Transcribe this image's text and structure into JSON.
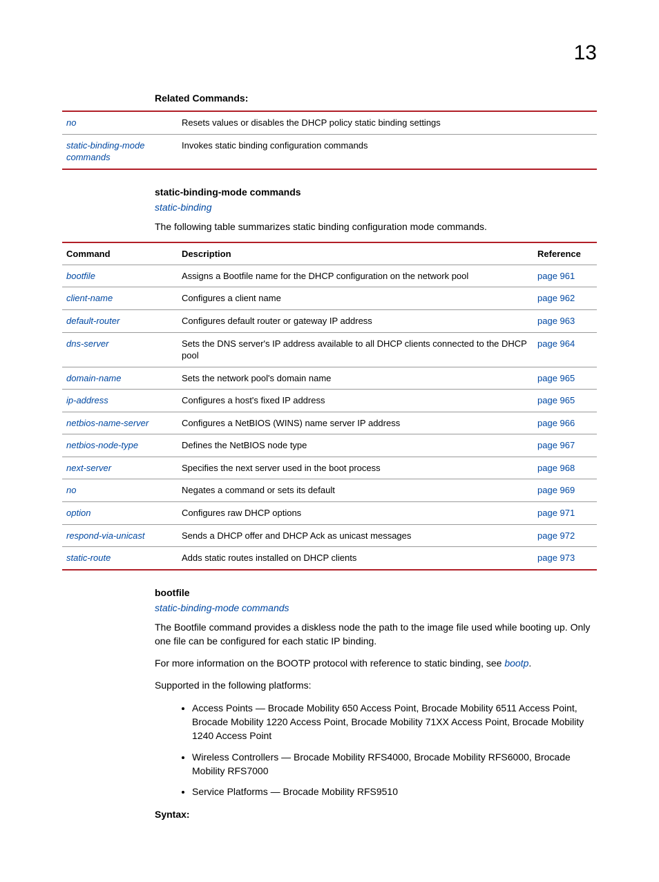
{
  "chapter_number": "13",
  "related_commands_heading": "Related Commands:",
  "related_commands": [
    {
      "cmd": "no",
      "desc": "Resets values or disables the DHCP policy static binding settings"
    },
    {
      "cmd": "static-binding-mode commands",
      "desc": "Invokes static binding configuration commands"
    }
  ],
  "sbm_heading": "static-binding-mode commands",
  "sbm_linkback": "static-binding",
  "sbm_intro": "The following table summarizes static binding configuration mode commands.",
  "sbm_table": {
    "headers": {
      "cmd": "Command",
      "desc": "Description",
      "ref": "Reference"
    },
    "rows": [
      {
        "cmd": "bootfile",
        "desc": "Assigns a Bootfile name for the DHCP configuration on the network pool",
        "ref": "page 961"
      },
      {
        "cmd": "client-name",
        "desc": "Configures a client name",
        "ref": "page 962"
      },
      {
        "cmd": "default-router",
        "desc": "Configures default router or gateway IP address",
        "ref": "page 963"
      },
      {
        "cmd": "dns-server",
        "desc": "Sets the DNS server's IP address available to all DHCP clients connected to the DHCP pool",
        "ref": "page 964"
      },
      {
        "cmd": "domain-name",
        "desc": "Sets the network pool's domain name",
        "ref": "page 965"
      },
      {
        "cmd": "ip-address",
        "desc": "Configures a host's fixed IP address",
        "ref": "page 965"
      },
      {
        "cmd": "netbios-name-server",
        "desc": "Configures a NetBIOS (WINS) name server IP address",
        "ref": "page 966"
      },
      {
        "cmd": "netbios-node-type",
        "desc": "Defines the NetBIOS node type",
        "ref": "page 967"
      },
      {
        "cmd": "next-server",
        "desc": "Specifies the next server used in the boot process",
        "ref": "page 968"
      },
      {
        "cmd": "no",
        "desc": "Negates a command or sets its default",
        "ref": "page 969"
      },
      {
        "cmd": "option",
        "desc": "Configures raw DHCP options",
        "ref": "page 971"
      },
      {
        "cmd": "respond-via-unicast",
        "desc": "Sends a DHCP offer and DHCP Ack as unicast messages",
        "ref": "page 972"
      },
      {
        "cmd": "static-route",
        "desc": "Adds static routes installed on DHCP clients",
        "ref": "page 973"
      }
    ]
  },
  "bootfile_heading": "bootfile",
  "bootfile_linkback": "static-binding-mode commands",
  "bootfile_p1": "The Bootfile command provides a diskless node the path to the image file used while booting up. Only one file can be configured for each static IP binding.",
  "bootfile_p2_pre": "For more information on the BOOTP protocol with reference to static binding, see ",
  "bootfile_p2_link": "bootp",
  "bootfile_p2_post": ".",
  "bootfile_p3": "Supported in the following platforms:",
  "platforms": [
    "Access Points — Brocade Mobility 650 Access Point, Brocade Mobility 6511 Access Point, Brocade Mobility 1220 Access Point, Brocade Mobility 71XX Access Point, Brocade Mobility 1240 Access Point",
    "Wireless Controllers — Brocade Mobility RFS4000, Brocade Mobility RFS6000, Brocade Mobility RFS7000",
    "Service Platforms — Brocade Mobility RFS9510"
  ],
  "syntax_heading": "Syntax:"
}
